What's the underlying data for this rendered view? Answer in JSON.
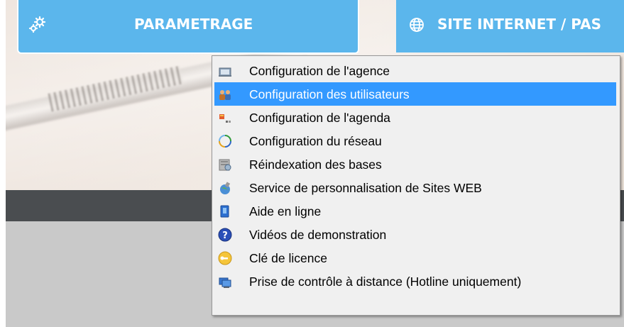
{
  "tabs": [
    {
      "label": "PARAMETRAGE",
      "icon": "gears-icon"
    },
    {
      "label": "SITE INTERNET / PAS",
      "icon": "globe-icon"
    }
  ],
  "menu": {
    "selected_index": 1,
    "items": [
      {
        "label": "Configuration de l'agence",
        "icon": "agency-config-icon"
      },
      {
        "label": "Configuration des utilisateurs",
        "icon": "users-icon"
      },
      {
        "label": "Configuration de l'agenda",
        "icon": "agenda-icon"
      },
      {
        "label": "Configuration du réseau",
        "icon": "network-refresh-icon"
      },
      {
        "label": "Réindexation des bases",
        "icon": "database-reindex-icon"
      },
      {
        "label": "Service de personnalisation de Sites WEB",
        "icon": "website-service-icon"
      },
      {
        "label": "Aide en ligne",
        "icon": "help-book-icon"
      },
      {
        "label": "Vidéos de demonstration",
        "icon": "question-icon"
      },
      {
        "label": "Clé de licence",
        "icon": "key-icon"
      },
      {
        "label": "Prise de contrôle à distance (Hotline uniquement)",
        "icon": "remote-control-icon"
      }
    ]
  },
  "colors": {
    "tab_blue": "#5bb6ec",
    "selection": "#3399ff",
    "menu_bg": "#f0f0f0"
  }
}
